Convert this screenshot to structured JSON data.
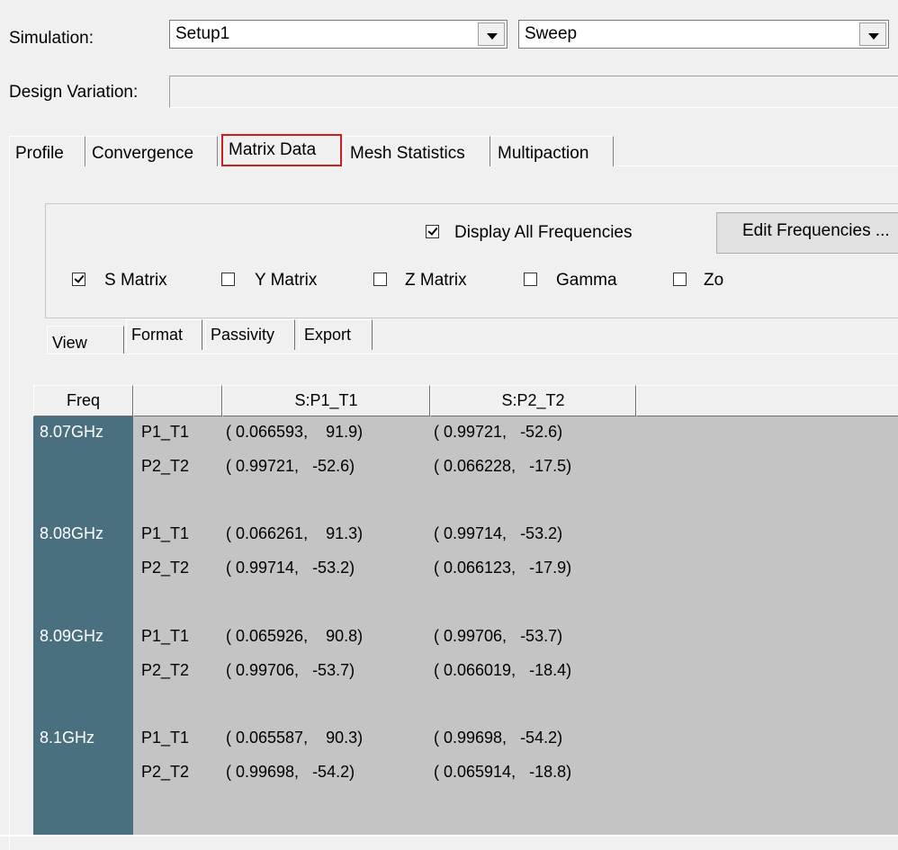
{
  "top": {
    "simulation_label": "Simulation:",
    "setup_value": "Setup1",
    "sweep_value": "Sweep",
    "design_variation_label": "Design Variation:",
    "design_variation_value": ""
  },
  "tabs": [
    "Profile",
    "Convergence",
    "Matrix Data",
    "Mesh Statistics",
    "Multipaction"
  ],
  "active_tab": "Matrix Data",
  "options": {
    "display_all_frequencies": {
      "label": "Display All Frequencies",
      "checked": true
    },
    "edit_frequencies_label": "Edit Frequencies ...",
    "matrices": [
      {
        "label": "S Matrix",
        "checked": true
      },
      {
        "label": "Y Matrix",
        "checked": false
      },
      {
        "label": "Z Matrix",
        "checked": false
      },
      {
        "label": "Gamma",
        "checked": false
      },
      {
        "label": "Zo",
        "checked": false
      }
    ]
  },
  "subtabs": [
    "View",
    "Format",
    "Passivity",
    "Export"
  ],
  "active_subtab": "View",
  "grid": {
    "headers": [
      "Freq",
      "",
      "S:P1_T1",
      "S:P2_T2"
    ],
    "rows": [
      {
        "freq": "8.07GHz",
        "port": "P1_T1",
        "c1": "( 0.066593,    91.9)",
        "c2": "( 0.99721,   -52.6)"
      },
      {
        "freq": "",
        "port": "P2_T2",
        "c1": "( 0.99721,   -52.6)",
        "c2": "( 0.066228,   -17.5)"
      },
      {
        "freq": "",
        "port": "",
        "c1": "",
        "c2": ""
      },
      {
        "freq": "8.08GHz",
        "port": "P1_T1",
        "c1": "( 0.066261,    91.3)",
        "c2": "( 0.99714,   -53.2)"
      },
      {
        "freq": "",
        "port": "P2_T2",
        "c1": "( 0.99714,   -53.2)",
        "c2": "( 0.066123,   -17.9)"
      },
      {
        "freq": "",
        "port": "",
        "c1": "",
        "c2": ""
      },
      {
        "freq": "8.09GHz",
        "port": "P1_T1",
        "c1": "( 0.065926,    90.8)",
        "c2": "( 0.99706,   -53.7)"
      },
      {
        "freq": "",
        "port": "P2_T2",
        "c1": "( 0.99706,   -53.7)",
        "c2": "( 0.066019,   -18.4)"
      },
      {
        "freq": "",
        "port": "",
        "c1": "",
        "c2": ""
      },
      {
        "freq": "8.1GHz",
        "port": "P1_T1",
        "c1": "( 0.065587,    90.3)",
        "c2": "( 0.99698,   -54.2)"
      },
      {
        "freq": "",
        "port": "P2_T2",
        "c1": "( 0.99698,   -54.2)",
        "c2": "( 0.065914,   -18.8)"
      },
      {
        "freq": "",
        "port": "",
        "c1": "",
        "c2": ""
      }
    ]
  }
}
